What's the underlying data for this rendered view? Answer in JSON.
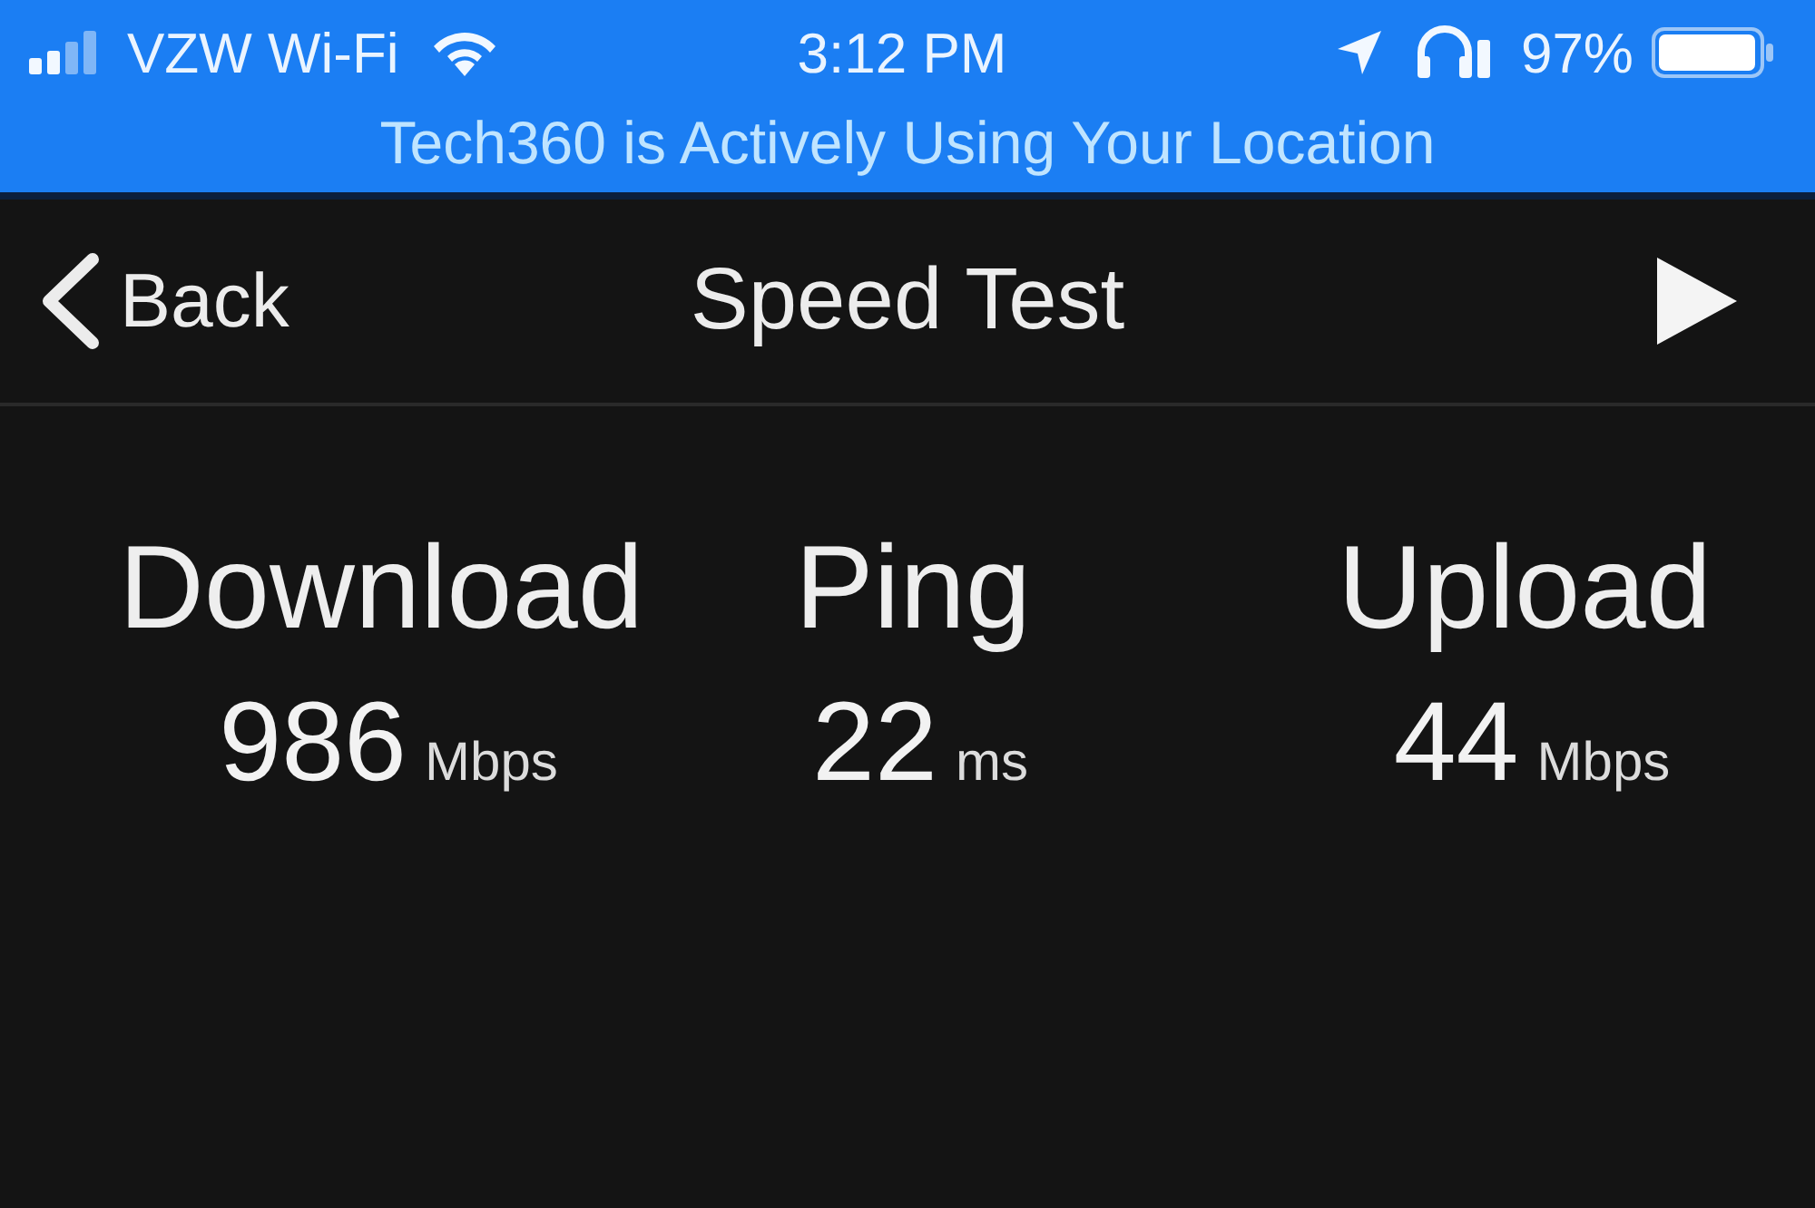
{
  "status_bar": {
    "carrier": "VZW Wi-Fi",
    "time": "3:12 PM",
    "battery_percent": "97%",
    "location_banner": "Tech360 is Actively Using Your Location"
  },
  "nav_bar": {
    "back_label": "Back",
    "title": "Speed Test"
  },
  "results": [
    {
      "label": "Download",
      "value": "986",
      "unit": "Mbps"
    },
    {
      "label": "Ping",
      "value": "22",
      "unit": "ms"
    },
    {
      "label": "Upload",
      "value": "44",
      "unit": "Mbps"
    }
  ]
}
